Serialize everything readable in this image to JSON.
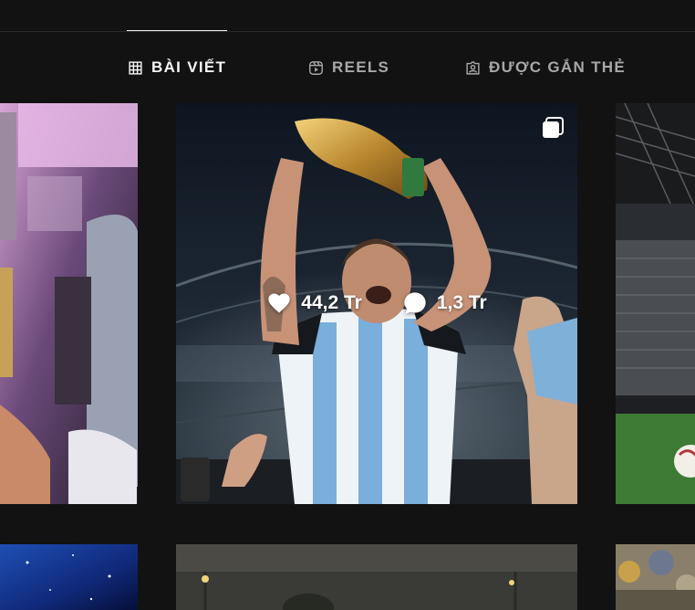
{
  "tabs": [
    {
      "label": "BÀI VIẾT",
      "icon": "grid-icon",
      "active": true
    },
    {
      "label": "REELS",
      "icon": "reels-icon",
      "active": false
    },
    {
      "label": "ĐƯỢC GẮN THẺ",
      "icon": "tagged-icon",
      "active": false
    }
  ],
  "featured_post": {
    "likes": "44,2 Tr",
    "comments": "1,3 Tr",
    "multi_icon": "multiple-images-icon"
  },
  "colors": {
    "background": "#121212",
    "active_tab": "#f5f5f5",
    "inactive_tab": "#a8a8a8"
  }
}
